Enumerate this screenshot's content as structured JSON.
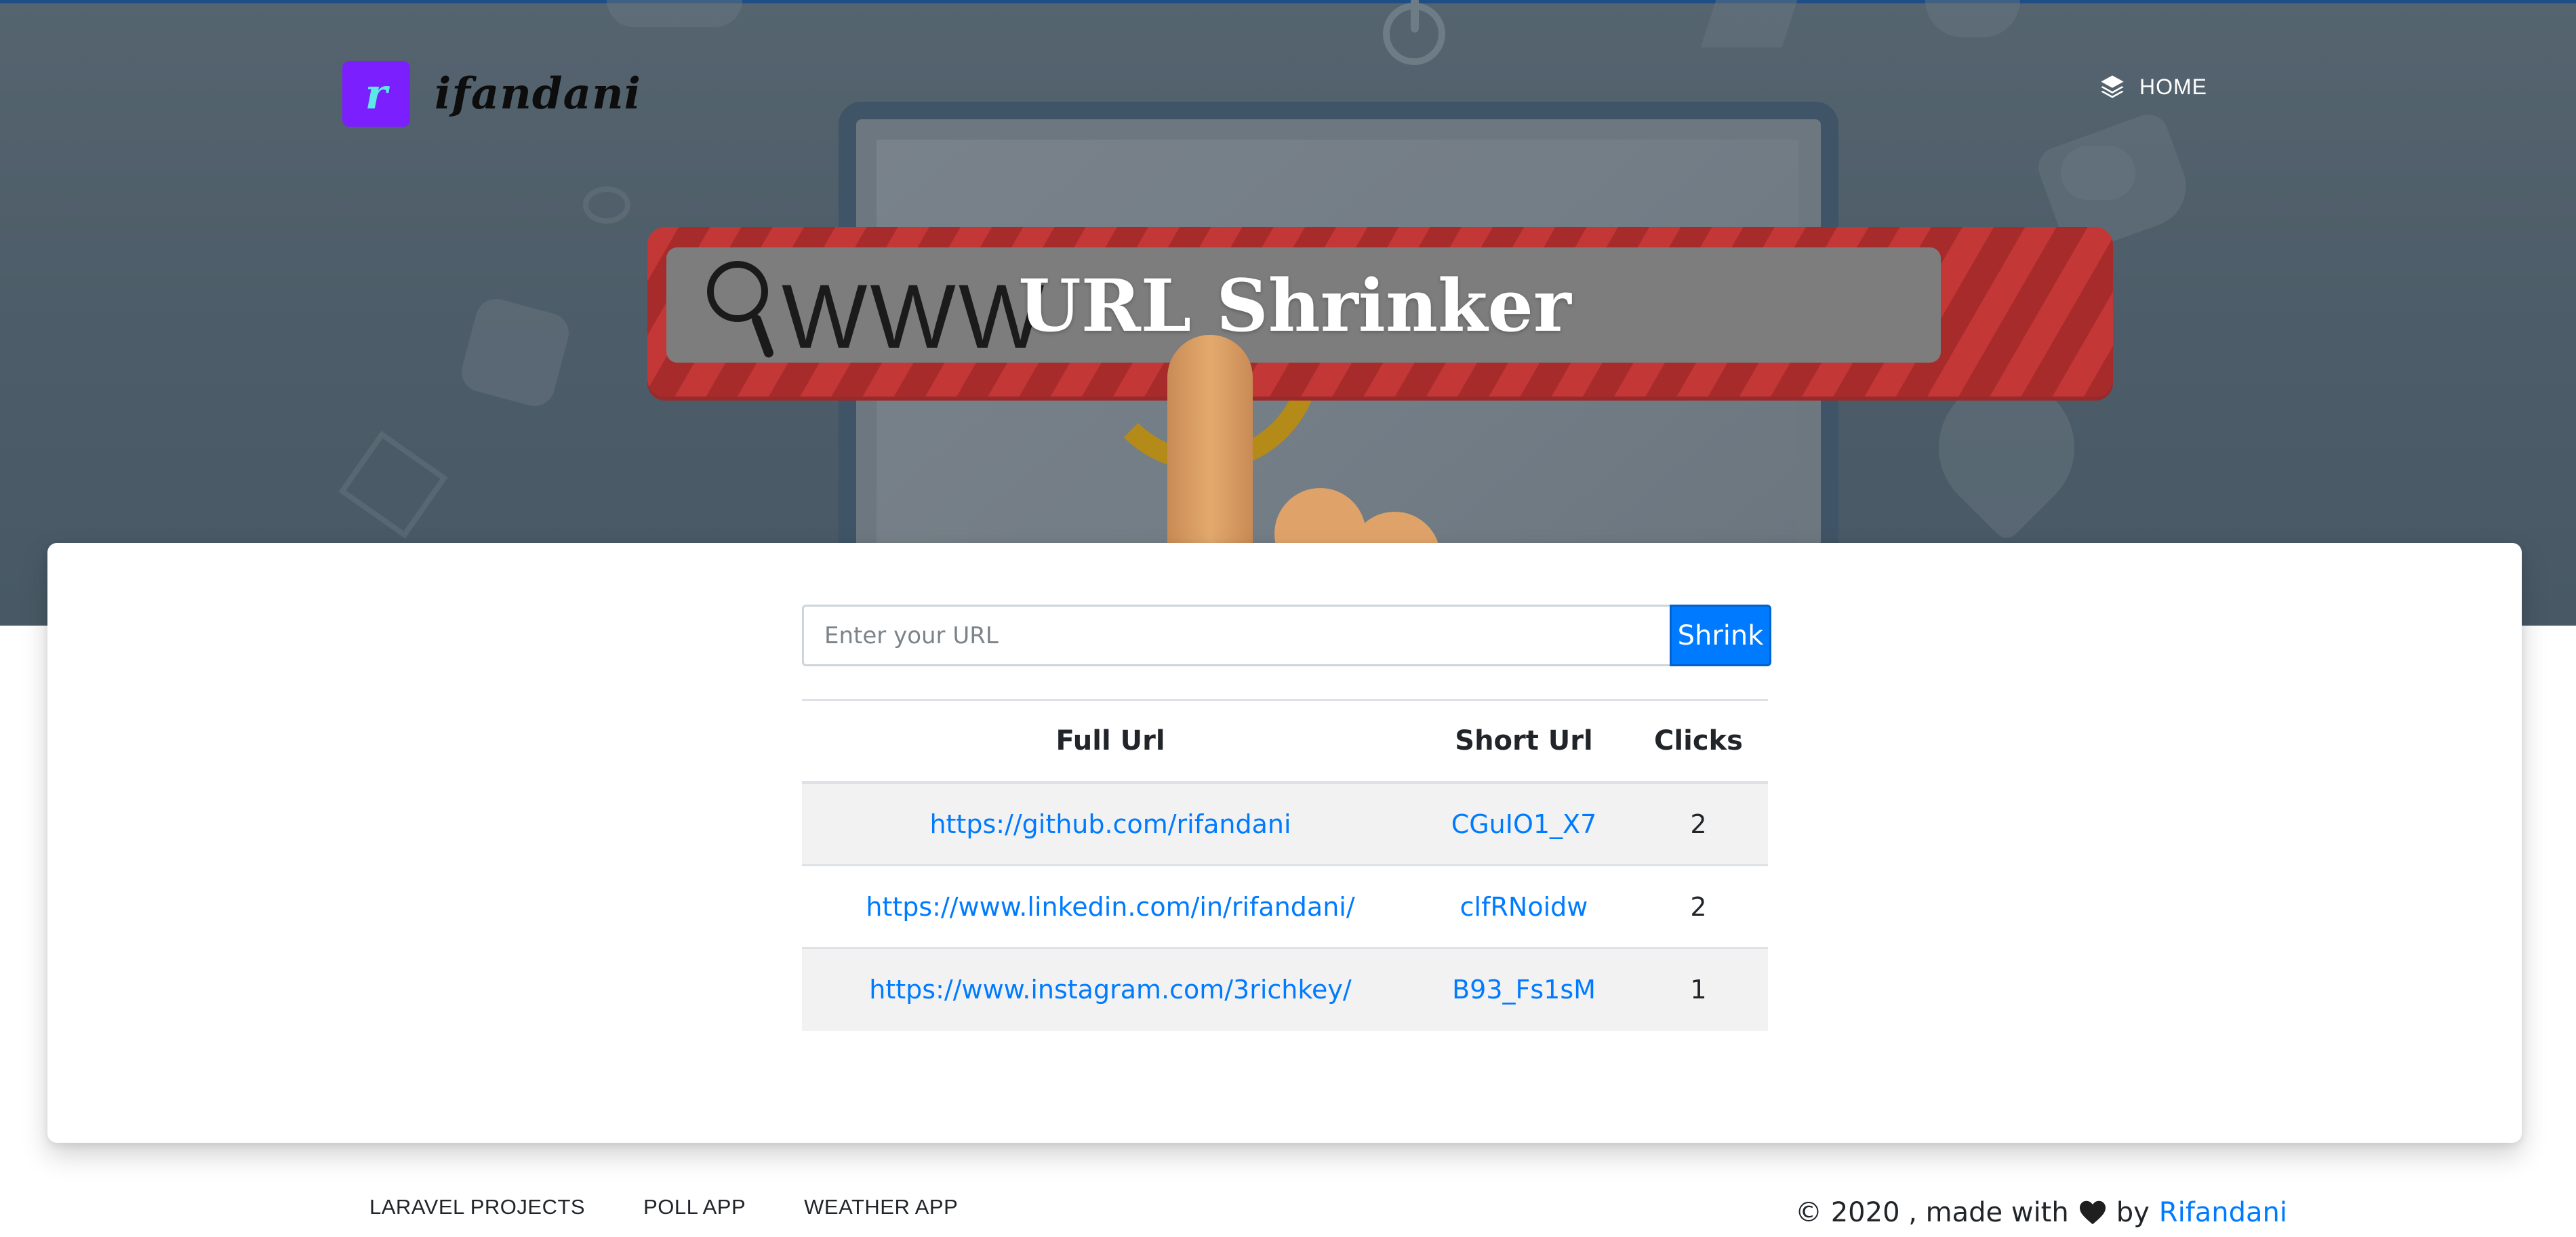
{
  "nav": {
    "brand_logo_letter": "r",
    "brand_name": "ifandani",
    "home_label": "HOME"
  },
  "hero": {
    "bar_text": "WWW",
    "title": "URL Shrinker"
  },
  "form": {
    "url_placeholder": "Enter your URL",
    "submit_label": "Shrink"
  },
  "table": {
    "headers": [
      "Full Url",
      "Short Url",
      "Clicks"
    ],
    "rows": [
      {
        "full_url": "https://github.com/rifandani",
        "short_url": "CGuIO1_X7",
        "clicks": "2"
      },
      {
        "full_url": "https://www.linkedin.com/in/rifandani/",
        "short_url": "clfRNoidw",
        "clicks": "2"
      },
      {
        "full_url": "https://www.instagram.com/3richkey/",
        "short_url": "B93_Fs1sM",
        "clicks": "1"
      }
    ]
  },
  "footer": {
    "links": [
      "LARAVEL PROJECTS",
      "POLL APP",
      "WEATHER APP"
    ],
    "copyright_prefix": "© 2020 , made with",
    "copyright_by": "by",
    "author": "Rifandani"
  },
  "colors": {
    "accent": "#007bff",
    "brand_logo_bg": "#7c1fff",
    "hero_bg": "#4f5f6b"
  },
  "icons": {
    "home": "layers-icon",
    "heart": "heart-icon",
    "search": "magnifier-icon"
  }
}
